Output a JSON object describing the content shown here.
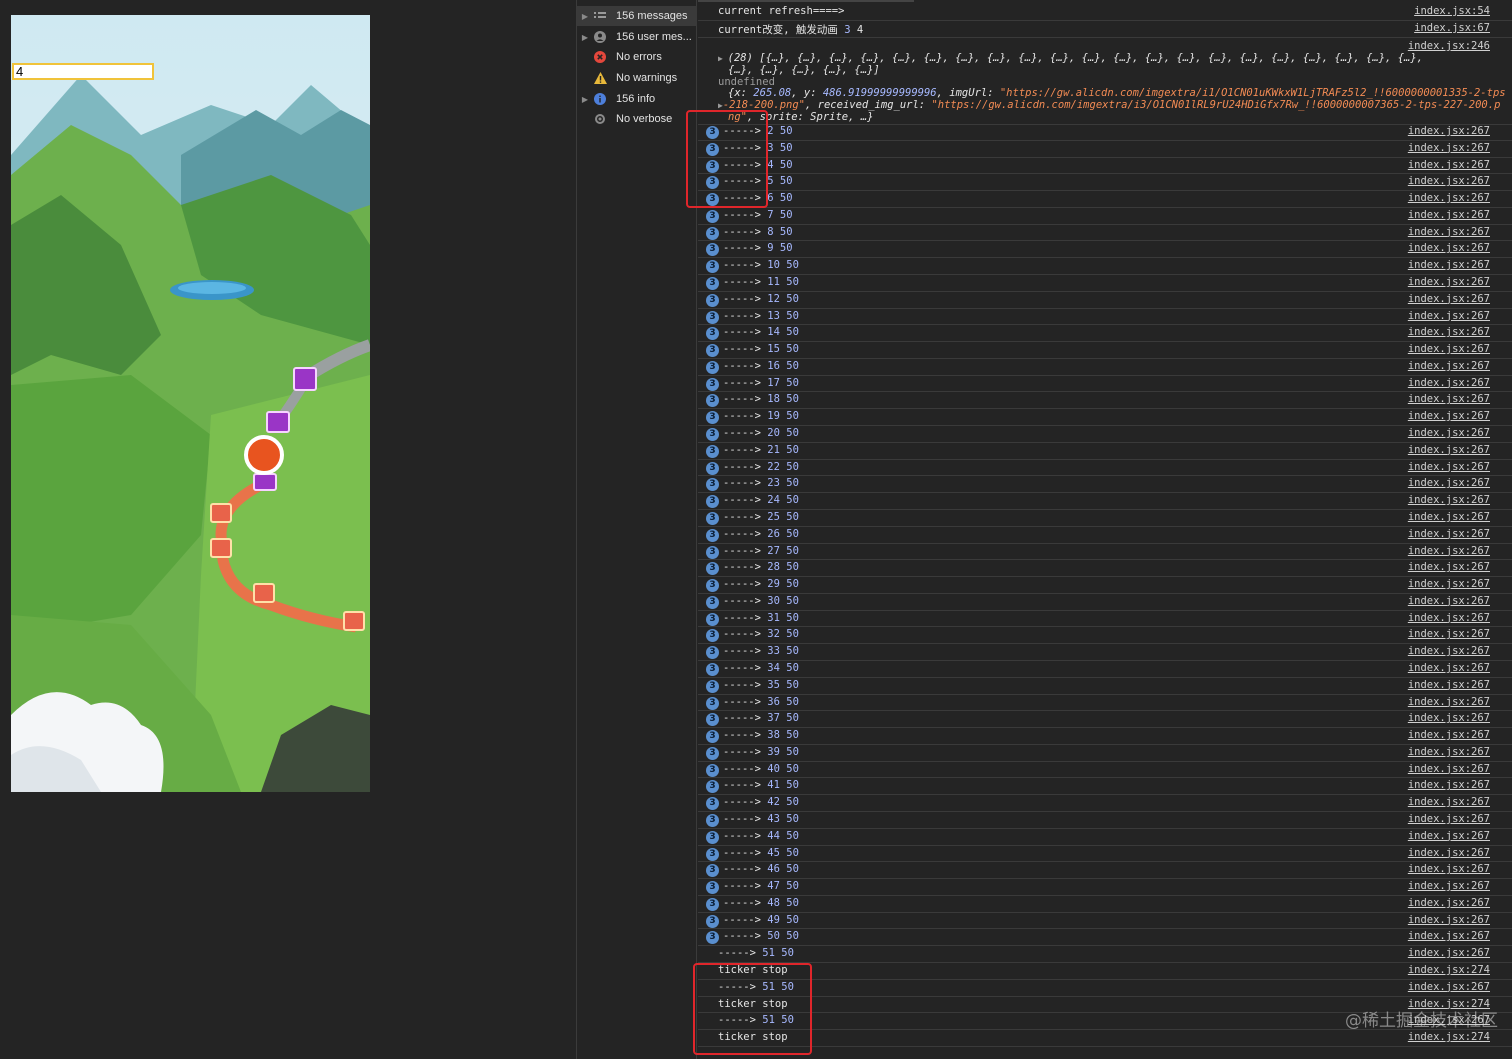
{
  "game": {
    "input_value": "4"
  },
  "sidebar": {
    "items": [
      {
        "label": "156 messages",
        "icon": "list-icon",
        "expandable": true,
        "selected": true
      },
      {
        "label": "156 user mes...",
        "icon": "user-icon",
        "expandable": true
      },
      {
        "label": "No errors",
        "icon": "error-icon",
        "expandable": false
      },
      {
        "label": "No warnings",
        "icon": "warning-icon",
        "expandable": false
      },
      {
        "label": "156 info",
        "icon": "info-icon",
        "expandable": true
      },
      {
        "label": "No verbose",
        "icon": "verbose-icon",
        "expandable": false
      }
    ]
  },
  "console": {
    "header_rows": [
      {
        "text": "current refresh====>",
        "source": "index.jsx:54"
      },
      {
        "text_prefix": "current改变, 触发动画 ",
        "num_a": "3",
        "num_b": " 4",
        "source": "index.jsx:67"
      }
    ],
    "array_row": {
      "source": "index.jsx:246",
      "line1": "(28) [{…}, {…}, {…}, {…}, {…}, {…}, {…}, {…}, {…}, {…}, {…}, {…}, {…}, {…}, {…}, {…}, {…}, {…}, {…}, {…}, {…},",
      "line2": "{…}, {…}, {…}, {…}, {…}]",
      "line3": "undefined",
      "obj_prefix": "{x: ",
      "x_val": "265.08",
      "y_sep": ", y: ",
      "y_val": "486.91999999999996",
      "img_key": ", imgUrl: ",
      "img_url_a": "\"https://gw.alicdn.com/imgextra/i1/O1CN01uKWkxW1LjTRAFz5l2_!!6000000001335-2-tps",
      "img_url_b": "-218-200.png\"",
      "recv_key": ", received_img_url: ",
      "recv_url": "\"https://gw.alicdn.com/imgextra/i3/O1CN01lRL9rU24HDiGfx7Rw_!!6000000007365-2-tps-227-200.p",
      "recv_url_b": "ng\"",
      "sprite": ", sprite: Sprite, …}"
    },
    "repeat_badge": "3",
    "log_rows": [
      {
        "arrow": "----->",
        "a": "2",
        "b": "50",
        "source": "index.jsx:267"
      },
      {
        "arrow": "----->",
        "a": "3",
        "b": "50",
        "source": "index.jsx:267"
      },
      {
        "arrow": "----->",
        "a": "4",
        "b": "50",
        "source": "index.jsx:267"
      },
      {
        "arrow": "----->",
        "a": "5",
        "b": "50",
        "source": "index.jsx:267"
      },
      {
        "arrow": "----->",
        "a": "6",
        "b": "50",
        "source": "index.jsx:267"
      },
      {
        "arrow": "----->",
        "a": "7",
        "b": "50",
        "source": "index.jsx:267"
      },
      {
        "arrow": "----->",
        "a": "8",
        "b": "50",
        "source": "index.jsx:267"
      },
      {
        "arrow": "----->",
        "a": "9",
        "b": "50",
        "source": "index.jsx:267"
      },
      {
        "arrow": "----->",
        "a": "10",
        "b": "50",
        "source": "index.jsx:267"
      },
      {
        "arrow": "----->",
        "a": "11",
        "b": "50",
        "source": "index.jsx:267"
      },
      {
        "arrow": "----->",
        "a": "12",
        "b": "50",
        "source": "index.jsx:267"
      },
      {
        "arrow": "----->",
        "a": "13",
        "b": "50",
        "source": "index.jsx:267"
      },
      {
        "arrow": "----->",
        "a": "14",
        "b": "50",
        "source": "index.jsx:267"
      },
      {
        "arrow": "----->",
        "a": "15",
        "b": "50",
        "source": "index.jsx:267"
      },
      {
        "arrow": "----->",
        "a": "16",
        "b": "50",
        "source": "index.jsx:267"
      },
      {
        "arrow": "----->",
        "a": "17",
        "b": "50",
        "source": "index.jsx:267"
      },
      {
        "arrow": "----->",
        "a": "18",
        "b": "50",
        "source": "index.jsx:267"
      },
      {
        "arrow": "----->",
        "a": "19",
        "b": "50",
        "source": "index.jsx:267"
      },
      {
        "arrow": "----->",
        "a": "20",
        "b": "50",
        "source": "index.jsx:267"
      },
      {
        "arrow": "----->",
        "a": "21",
        "b": "50",
        "source": "index.jsx:267"
      },
      {
        "arrow": "----->",
        "a": "22",
        "b": "50",
        "source": "index.jsx:267"
      },
      {
        "arrow": "----->",
        "a": "23",
        "b": "50",
        "source": "index.jsx:267"
      },
      {
        "arrow": "----->",
        "a": "24",
        "b": "50",
        "source": "index.jsx:267"
      },
      {
        "arrow": "----->",
        "a": "25",
        "b": "50",
        "source": "index.jsx:267"
      },
      {
        "arrow": "----->",
        "a": "26",
        "b": "50",
        "source": "index.jsx:267"
      },
      {
        "arrow": "----->",
        "a": "27",
        "b": "50",
        "source": "index.jsx:267"
      },
      {
        "arrow": "----->",
        "a": "28",
        "b": "50",
        "source": "index.jsx:267"
      },
      {
        "arrow": "----->",
        "a": "29",
        "b": "50",
        "source": "index.jsx:267"
      },
      {
        "arrow": "----->",
        "a": "30",
        "b": "50",
        "source": "index.jsx:267"
      },
      {
        "arrow": "----->",
        "a": "31",
        "b": "50",
        "source": "index.jsx:267"
      },
      {
        "arrow": "----->",
        "a": "32",
        "b": "50",
        "source": "index.jsx:267"
      },
      {
        "arrow": "----->",
        "a": "33",
        "b": "50",
        "source": "index.jsx:267"
      },
      {
        "arrow": "----->",
        "a": "34",
        "b": "50",
        "source": "index.jsx:267"
      },
      {
        "arrow": "----->",
        "a": "35",
        "b": "50",
        "source": "index.jsx:267"
      },
      {
        "arrow": "----->",
        "a": "36",
        "b": "50",
        "source": "index.jsx:267"
      },
      {
        "arrow": "----->",
        "a": "37",
        "b": "50",
        "source": "index.jsx:267"
      },
      {
        "arrow": "----->",
        "a": "38",
        "b": "50",
        "source": "index.jsx:267"
      },
      {
        "arrow": "----->",
        "a": "39",
        "b": "50",
        "source": "index.jsx:267"
      },
      {
        "arrow": "----->",
        "a": "40",
        "b": "50",
        "source": "index.jsx:267"
      },
      {
        "arrow": "----->",
        "a": "41",
        "b": "50",
        "source": "index.jsx:267"
      },
      {
        "arrow": "----->",
        "a": "42",
        "b": "50",
        "source": "index.jsx:267"
      },
      {
        "arrow": "----->",
        "a": "43",
        "b": "50",
        "source": "index.jsx:267"
      },
      {
        "arrow": "----->",
        "a": "44",
        "b": "50",
        "source": "index.jsx:267"
      },
      {
        "arrow": "----->",
        "a": "45",
        "b": "50",
        "source": "index.jsx:267"
      },
      {
        "arrow": "----->",
        "a": "46",
        "b": "50",
        "source": "index.jsx:267"
      },
      {
        "arrow": "----->",
        "a": "47",
        "b": "50",
        "source": "index.jsx:267"
      },
      {
        "arrow": "----->",
        "a": "48",
        "b": "50",
        "source": "index.jsx:267"
      },
      {
        "arrow": "----->",
        "a": "49",
        "b": "50",
        "source": "index.jsx:267"
      },
      {
        "arrow": "----->",
        "a": "50",
        "b": "50",
        "source": "index.jsx:267"
      }
    ],
    "tail_rows": [
      {
        "type": "arrow",
        "arrow": "----->",
        "a": "51",
        "b": "50",
        "source": "index.jsx:267"
      },
      {
        "type": "text",
        "text": "ticker stop",
        "source": "index.jsx:274"
      },
      {
        "type": "arrow",
        "arrow": "----->",
        "a": "51",
        "b": "50",
        "source": "index.jsx:267"
      },
      {
        "type": "text",
        "text": "ticker stop",
        "source": "index.jsx:274"
      },
      {
        "type": "arrow",
        "arrow": "----->",
        "a": "51",
        "b": "50",
        "source": "index.jsx:267"
      },
      {
        "type": "text",
        "text": "ticker stop",
        "source": "index.jsx:274"
      }
    ]
  },
  "watermark": "@稀土掘金技术社区",
  "colors": {
    "highlight": "#e0262b",
    "badge": "#5a8fcf",
    "number": "#a7b9ff",
    "string": "#f28b54"
  }
}
